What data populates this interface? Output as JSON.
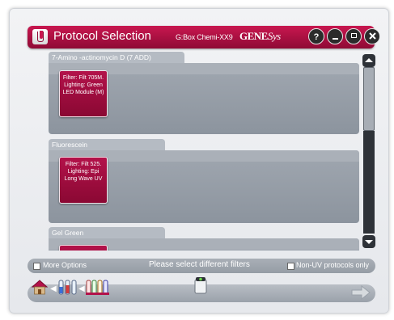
{
  "titlebar": {
    "title": "Protocol Selection",
    "device_name": "G:Box Chemi-XX9",
    "brand_prefix": "GENE",
    "brand_suffix": "Sys",
    "help_label": "?"
  },
  "groups": [
    {
      "name": "7-Amino -actinomycin D (7 ADD)",
      "cards": [
        {
          "text": "Filter: Filt 705M. Lighting: Green LED Module (M)"
        }
      ]
    },
    {
      "name": "Fluorescein",
      "cards": [
        {
          "text": "Filter: Filt 525. Lighting: Epi Long Wave UV"
        }
      ]
    },
    {
      "name": "Gel Green",
      "cards": [
        {
          "text": ""
        }
      ]
    }
  ],
  "options": {
    "more_options": "More Options",
    "message": "Please select different filters",
    "non_uv": "Non-UV protocols only"
  },
  "scrollbar": {
    "up_icon": "arrow-up-icon",
    "down_icon": "arrow-down-icon"
  },
  "colors": {
    "accent": "#b3124a",
    "titlebar": "#a8103f",
    "panel": "#959ca5"
  }
}
